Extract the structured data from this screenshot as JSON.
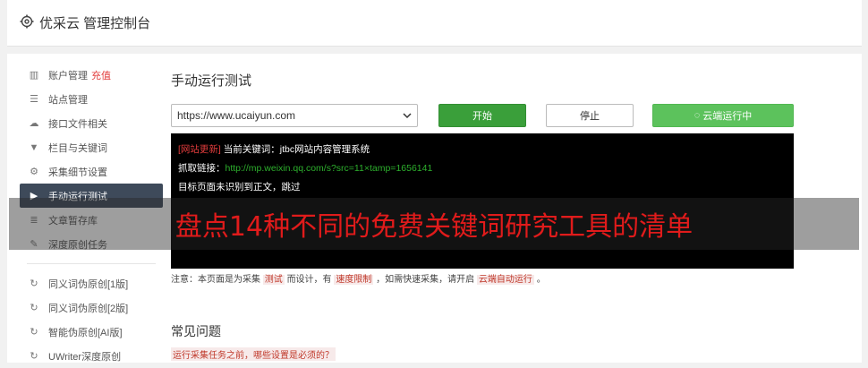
{
  "app": {
    "title": "优采云 管理控制台"
  },
  "sidebar": {
    "items": [
      {
        "icon": "bar-chart-icon",
        "label": "账户管理",
        "tag": "充值"
      },
      {
        "icon": "server-icon",
        "label": "站点管理"
      },
      {
        "icon": "cloud-upload-icon",
        "label": "接口文件相关"
      },
      {
        "icon": "filter-icon",
        "label": "栏目与关键词"
      },
      {
        "icon": "gears-icon",
        "label": "采集细节设置"
      },
      {
        "icon": "play-icon",
        "label": "手动运行测试"
      },
      {
        "icon": "database-icon",
        "label": "文章暂存库"
      },
      {
        "icon": "edit-icon",
        "label": "深度原创任务"
      }
    ],
    "items2": [
      {
        "icon": "refresh-icon",
        "label": "同义词伪原创[1版]"
      },
      {
        "icon": "refresh-icon",
        "label": "同义词伪原创[2版]"
      },
      {
        "icon": "refresh-icon",
        "label": "智能伪原创[AI版]"
      },
      {
        "icon": "refresh-icon",
        "label": "UWriter深度原创"
      }
    ]
  },
  "main": {
    "title": "手动运行测试",
    "url_value": "https://www.ucaiyun.com",
    "buttons": {
      "start": "开始",
      "stop": "停止",
      "cloud": "云端运行中"
    },
    "console": {
      "tag": "[网站更新]",
      "line1": " 当前关键词：jtbc网站内容管理系统",
      "line2_label": "抓取链接：",
      "line2_url": "http://mp.weixin.qq.com/s?src=11×tamp=1656141",
      "line3": "目标页面未识别到正文，跳过"
    },
    "note": {
      "p1": "注意：本页面是为采集",
      "k1": "测试",
      "p2": "而设计，有",
      "k2": "速度限制",
      "p3": "，如需快速采集，请开启",
      "k3": "云端自动运行",
      "p4": "。"
    },
    "faq_title": "常见问题",
    "faq_link": "运行采集任务之前，哪些设置是必须的？"
  },
  "overlay": {
    "text": "盘点14种不同的免费关键词研究工具的清单"
  }
}
